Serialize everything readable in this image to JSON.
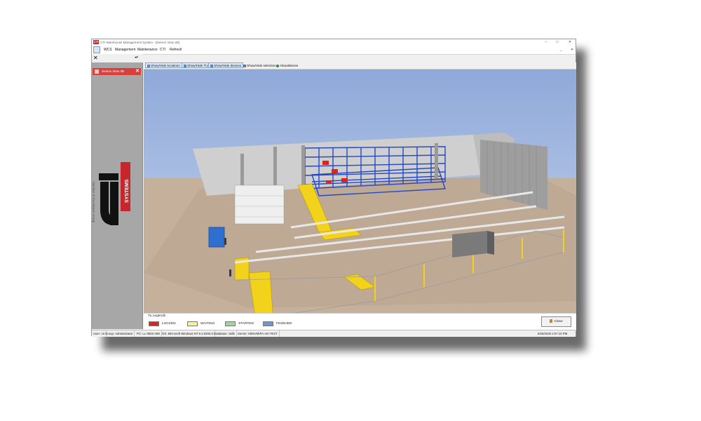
{
  "window": {
    "title": "CTI Warehouse Management System - [Device View 3D]",
    "logo_text": "CTI",
    "controls": {
      "minimize": "–",
      "maximize": "□",
      "close": "✕"
    },
    "inner_controls": {
      "minimize": "_",
      "maximize": "□",
      "close": "✕"
    }
  },
  "menubar": {
    "items": [
      "WCS",
      "Management",
      "Maintenance",
      "CTI",
      "Refresh"
    ]
  },
  "sidebar": {
    "close_glyph": "✕",
    "pin_glyph": "◂×",
    "tab": {
      "label": "Device View 3D",
      "close_glyph": "✕"
    },
    "brand_text": "Member of the Maurer Group"
  },
  "toolbar": {
    "buttons": [
      {
        "label": "Show/Hide locations",
        "icon": "locations-icon"
      },
      {
        "label": "Show/Hide TUs",
        "icon": "tus-icon"
      },
      {
        "label": "Show/Hide devices",
        "icon": "devices-icon"
      },
      {
        "label": "Show/Hide selection",
        "icon": "cursor-icon"
      },
      {
        "label": "Aktualisieren",
        "icon": "refresh-icon"
      }
    ]
  },
  "legend": {
    "title": "Tu Legends",
    "items": [
      {
        "label": "LOCKED",
        "color": "#e3231a"
      },
      {
        "label": "WAITING",
        "color": "#f6f29a"
      },
      {
        "label": "STARTED",
        "color": "#9fd69b"
      },
      {
        "label": "FINISHED",
        "color": "#6f97cf"
      }
    ],
    "close_label": "Close"
  },
  "statusbar": {
    "items": [
      "User: cti",
      "Group: Administrator",
      "PC: LL-0602-408",
      "OS: Microsoft Windows NT 6.2.9200.0",
      "Database: ctidb",
      "Server: HBSVM\\PA-AD-TEST"
    ],
    "datetime": "5/25/2020 2:07:10 PM"
  },
  "colors": {
    "accent": "#d9403b",
    "brand_red": "#c8252c",
    "rack_blue": "#2448c6",
    "crane_yellow": "#f2d21b"
  }
}
